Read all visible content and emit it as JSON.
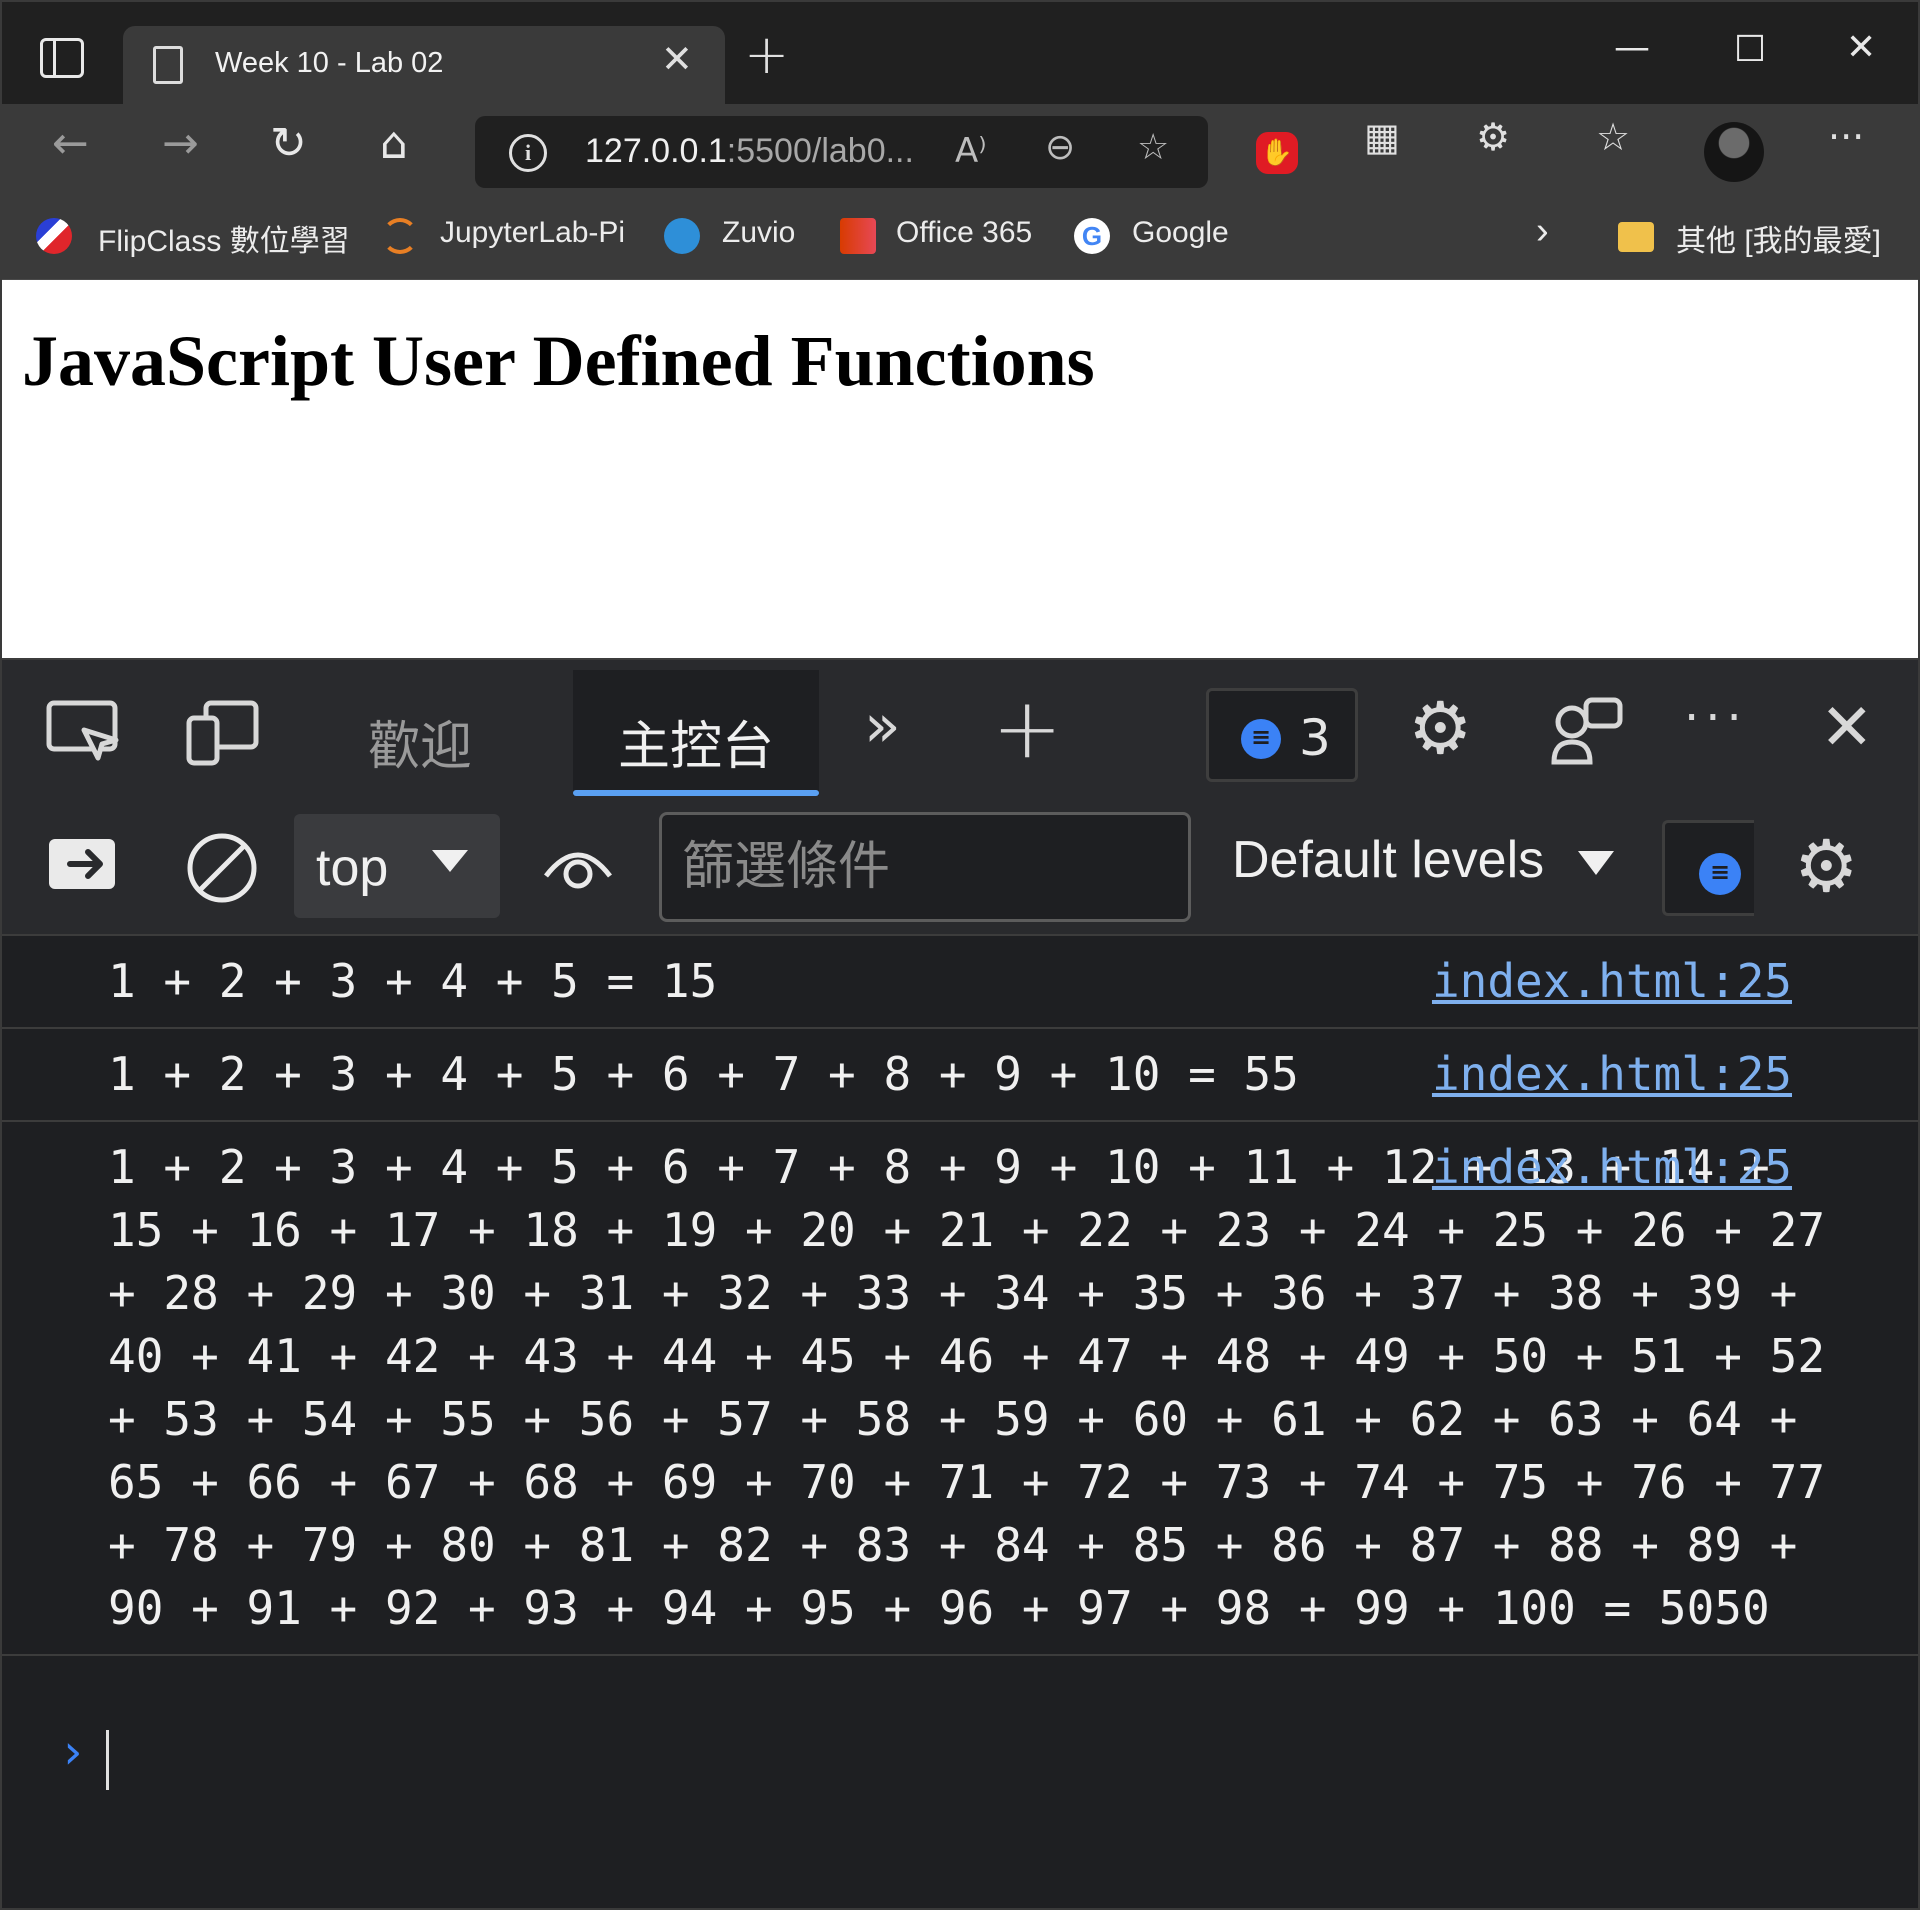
{
  "browser": {
    "tab_title": "Week 10 - Lab 02",
    "url_host": "127.0.0.1",
    "url_rest": ":5500/lab0...",
    "bookmarks": [
      {
        "label": "FlipClass 數位學習",
        "icon": "flipclass-icon"
      },
      {
        "label": "JupyterLab-Pi",
        "icon": "jupyter-icon"
      },
      {
        "label": "Zuvio",
        "icon": "zuvio-icon"
      },
      {
        "label": "Office 365",
        "icon": "office-icon"
      },
      {
        "label": "Google",
        "icon": "google-icon"
      }
    ],
    "other_favorites": "其他 [我的最愛]"
  },
  "page": {
    "heading": "JavaScript User Defined Functions"
  },
  "devtools": {
    "tabs": [
      "歡迎",
      "主控台"
    ],
    "active_tab": "主控台",
    "issues_count": "3",
    "context": "top",
    "filter_placeholder": "篩選條件",
    "levels": "Default levels",
    "messages": [
      {
        "text": "1 + 2 + 3 + 4 + 5 = 15",
        "source": "index.html:25"
      },
      {
        "text": "1 + 2 + 3 + 4 + 5 + 6 + 7 + 8 + 9 + 10 = 55",
        "source": "index.html:25"
      },
      {
        "text": "1 + 2 + 3 + 4 + 5 + 6 + 7 + 8 + 9 + 10 + 11 + 12 + 13 + 14 + 15 + 16 + 17 + 18 + 19 + 20 + 21 + 22 + 23 + 24 + 25 + 26 + 27 + 28 + 29 + 30 + 31 + 32 + 33 + 34 + 35 + 36 + 37 + 38 + 39 + 40 + 41 + 42 + 43 + 44 + 45 + 46 + 47 + 48 + 49 + 50 + 51 + 52 + 53 + 54 + 55 + 56 + 57 + 58 + 59 + 60 + 61 + 62 + 63 + 64 + 65 + 66 + 67 + 68 + 69 + 70 + 71 + 72 + 73 + 74 + 75 + 76 + 77 + 78 + 79 + 80 + 81 + 82 + 83 + 84 + 85 + 86 + 87 + 88 + 89 + 90 + 91 + 92 + 93 + 94 + 95 + 96 + 97 + 98 + 99 + 100 = 5050",
        "source": "index.html:25"
      }
    ],
    "accent_color": "#5aa0f2"
  }
}
